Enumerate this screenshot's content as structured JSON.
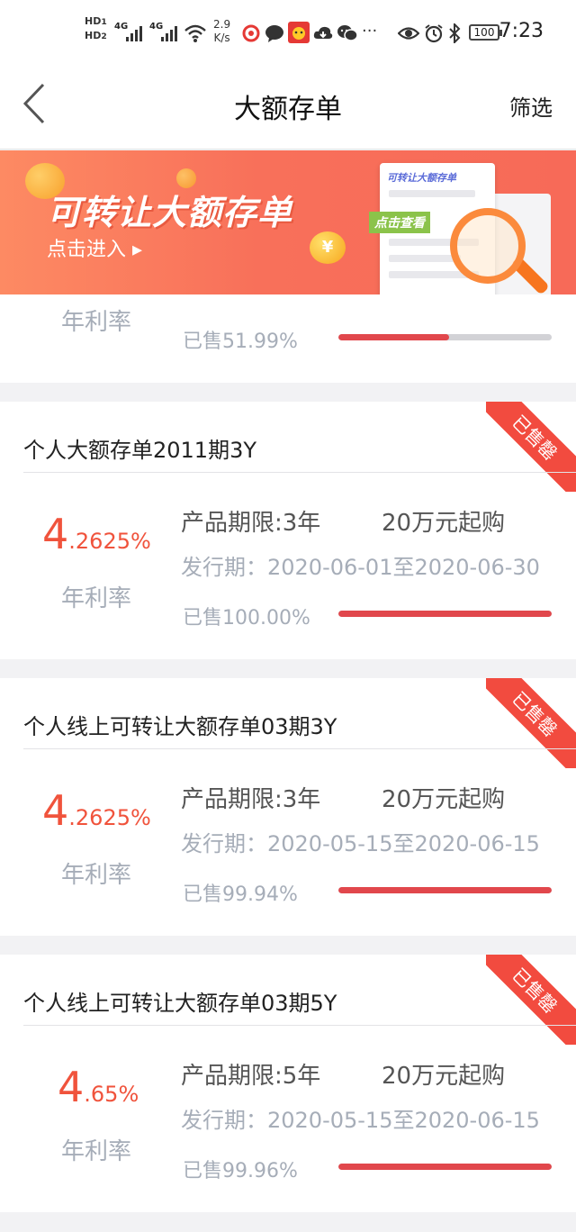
{
  "status_bar": {
    "hd1": "HD",
    "hd1_sub": "1",
    "hd2": "HD",
    "hd2_sub": "2",
    "net1": "4G",
    "net2": "4G",
    "speed_value": "2.9",
    "speed_unit": "K/s",
    "battery": "100",
    "time": "7:23",
    "more": "···"
  },
  "nav": {
    "title": "大额存单",
    "filter_label": "筛选"
  },
  "banner": {
    "title": "可转让大额存单",
    "subtitle": "点击进入 ▸",
    "paper_heading": "可转让大额存单",
    "paper_tag": "点击查看",
    "coin_symbol": "¥"
  },
  "partial_card": {
    "rate_label": "年利率",
    "sold_text": "已售51.99%",
    "sold_fraction": 0.5199
  },
  "products": [
    {
      "title": "个人大额存单2011期3Y",
      "rate_int": "4",
      "rate_dec": ".2625%",
      "rate_label": "年利率",
      "term": "产品期限:3年",
      "min_buy": "20万元起购",
      "issue": "发行期：2020-06-01至2020-06-30",
      "sold_text": "已售100.00%",
      "sold_fraction": 1.0,
      "badge": "已售罄"
    },
    {
      "title": "个人线上可转让大额存单03期3Y",
      "rate_int": "4",
      "rate_dec": ".2625%",
      "rate_label": "年利率",
      "term": "产品期限:3年",
      "min_buy": "20万元起购",
      "issue": "发行期：2020-05-15至2020-06-15",
      "sold_text": "已售99.94%",
      "sold_fraction": 0.9994,
      "badge": "已售罄"
    },
    {
      "title": "个人线上可转让大额存单03期5Y",
      "rate_int": "4",
      "rate_dec": ".65%",
      "rate_label": "年利率",
      "term": "产品期限:5年",
      "min_buy": "20万元起购",
      "issue": "发行期：2020-05-15至2020-06-15",
      "sold_text": "已售99.96%",
      "sold_fraction": 0.9996,
      "badge": "已售罄"
    }
  ],
  "colors": {
    "accent": "#f0533c",
    "progress": "#e1474c",
    "badge": "#f24b3f",
    "muted_text": "#a6adb8"
  }
}
